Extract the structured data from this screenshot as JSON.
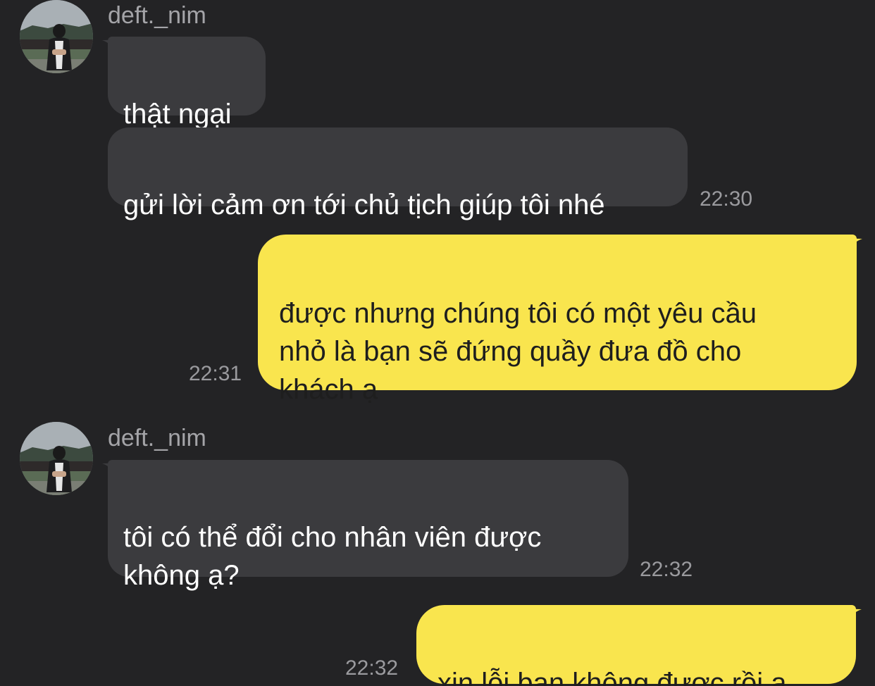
{
  "colors": {
    "background": "#232325",
    "incoming_bubble": "#3b3b3e",
    "outgoing_bubble": "#f9e54e",
    "incoming_text": "#ffffff",
    "outgoing_text": "#1e1e1e",
    "meta_text": "#9a9a9e"
  },
  "messages": [
    {
      "sender": "deft._nim",
      "avatar_icon": "profile-photo-avatar",
      "bubbles": [
        "thật ngại",
        "gửi lời cảm ơn tới chủ tịch giúp tôi nhé"
      ],
      "time": "22:30"
    },
    {
      "sender": "me",
      "bubbles": [
        "được nhưng chúng tôi có một yêu cầu\nnhỏ là bạn sẽ đứng quầy đưa đồ cho\nkhách ạ"
      ],
      "time": "22:31"
    },
    {
      "sender": "deft._nim",
      "avatar_icon": "profile-photo-avatar",
      "bubbles": [
        "tôi có thể đổi cho nhân viên được\nkhông ạ?"
      ],
      "time": "22:32"
    },
    {
      "sender": "me",
      "bubbles": [
        "xin lỗi bạn không được rồi ạ"
      ],
      "time": "22:32"
    }
  ]
}
